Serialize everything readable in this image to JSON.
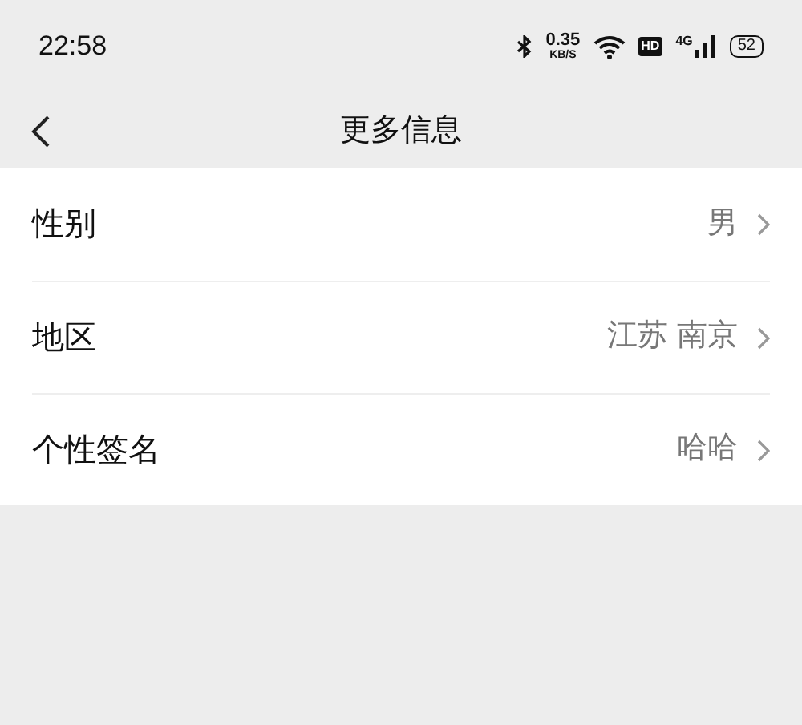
{
  "status_bar": {
    "time": "22:58",
    "speed": "0.35",
    "speed_unit": "KB/S",
    "hd": "HD",
    "network": "4G",
    "battery": "52"
  },
  "header": {
    "title": "更多信息"
  },
  "rows": [
    {
      "label": "性别",
      "value": "男"
    },
    {
      "label": "地区",
      "value": "江苏 南京"
    },
    {
      "label": "个性签名",
      "value": "哈哈"
    }
  ]
}
